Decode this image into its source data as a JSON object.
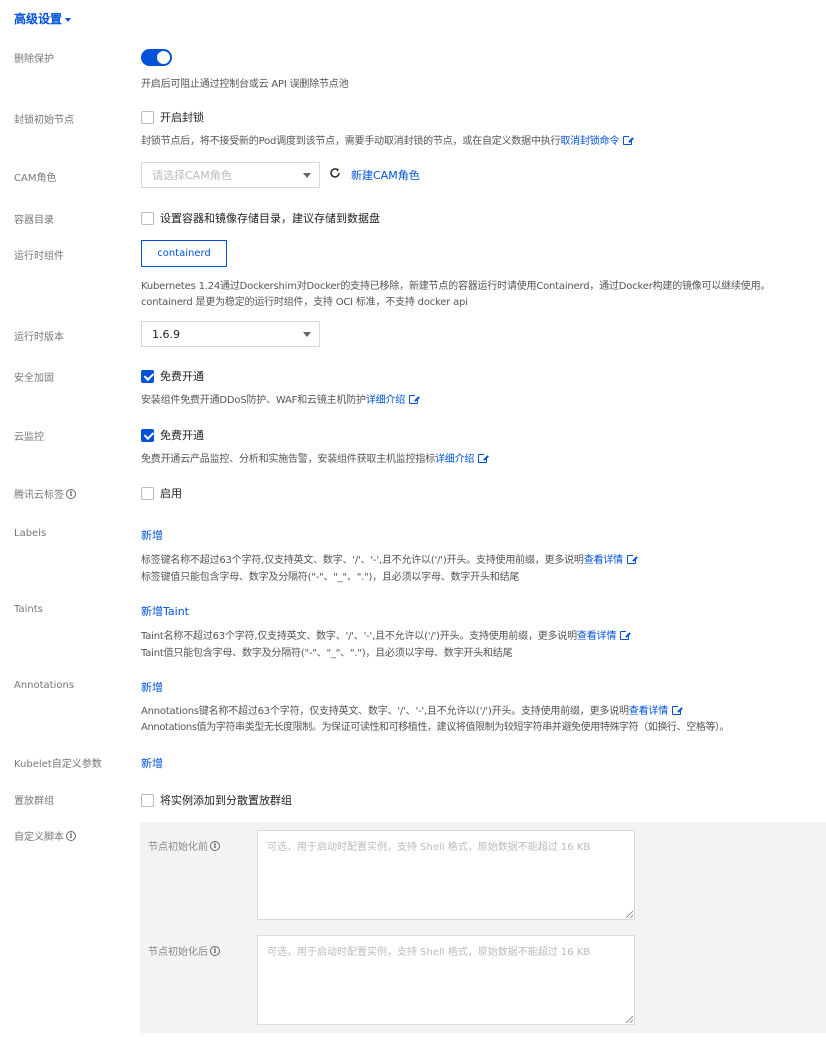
{
  "section_title": "高级设置",
  "delete_protection": {
    "label": "删除保护",
    "enabled": true,
    "help": "开启后可阻止通过控制台或云 API 误删除节点池"
  },
  "cordon": {
    "label": "封锁初始节点",
    "checkbox_label": "开启封锁",
    "checked": false,
    "help": "封锁节点后，将不接受新的Pod调度到该节点，需要手动取消封锁的节点，或在自定义数据中执行",
    "link": "取消封锁命令"
  },
  "cam": {
    "label": "CAM角色",
    "placeholder": "请选择CAM角色",
    "new_link": "新建CAM角色"
  },
  "container_dir": {
    "label": "容器目录",
    "checkbox_label": "设置容器和镜像存储目录，建议存储到数据盘",
    "checked": false
  },
  "runtime": {
    "label": "运行时组件",
    "selected": "containerd",
    "help_line1": "Kubernetes 1.24通过Dockershim对Docker的支持已移除，新建节点的容器运行时请使用Containerd，通过Docker构建的镜像可以继续使用。",
    "help_line2": "containerd 是更为稳定的运行时组件，支持 OCI 标准，不支持 docker api"
  },
  "runtime_version": {
    "label": "运行时版本",
    "value": "1.6.9"
  },
  "security": {
    "label": "安全加固",
    "checkbox_label": "免费开通",
    "checked": true,
    "help": "安装组件免费开通DDoS防护、WAF和云镜主机防护",
    "link": "详细介绍"
  },
  "monitor": {
    "label": "云监控",
    "checkbox_label": "免费开通",
    "checked": true,
    "help": "免费开通云产品监控、分析和实施告警，安装组件获取主机监控指标",
    "link": "详细介绍"
  },
  "tags": {
    "label": "腾讯云标签",
    "checkbox_label": "启用",
    "checked": false
  },
  "labels": {
    "label": "Labels",
    "add": "新增",
    "help_line1": "标签键名称不超过63个字符,仅支持英文、数字、'/'、'-',且不允许以('/')开头。支持使用前缀，更多说明",
    "link": "查看详情",
    "help_line2": "标签键值只能包含字母、数字及分隔符(\"-\"、\"_\"、\".\")，且必须以字母、数字开头和结尾"
  },
  "taints": {
    "label": "Taints",
    "add": "新增Taint",
    "help_line1": "Taint名称不超过63个字符,仅支持英文、数字、'/'、'-',且不允许以('/')开头。支持使用前缀，更多说明",
    "link": "查看详情",
    "help_line2": "Taint值只能包含字母、数字及分隔符(\"-\"、\"_\"、\".\")，且必须以字母、数字开头和结尾"
  },
  "annotations": {
    "label": "Annotations",
    "add": "新增",
    "help_line1": "Annotations键名称不超过63个字符，仅支持英文、数字、'/'、'-',且不允许以('/')开头。支持使用前缀，更多说明",
    "link": "查看详情",
    "help_line2": "Annotations值为字符串类型无长度限制。为保证可读性和可移植性，建议将值限制为较短字符串并避免使用特殊字符（如换行、空格等）。"
  },
  "kubelet": {
    "label": "Kubelet自定义参数",
    "add": "新增"
  },
  "placement": {
    "label": "置放群组",
    "checkbox_label": "将实例添加到分散置放群组",
    "checked": false
  },
  "script": {
    "label": "自定义脚本",
    "pre_label": "节点初始化前",
    "pre_placeholder": "可选，用于启动时配置实例，支持 Shell 格式，原始数据不能超过 16 KB",
    "post_label": "节点初始化后",
    "post_placeholder": "可选，用于启动时配置实例，支持 Shell 格式，原始数据不能超过 16 KB"
  },
  "colors": {
    "primary": "#0052d9",
    "label_gray": "#777777",
    "help_gray": "#555555"
  }
}
